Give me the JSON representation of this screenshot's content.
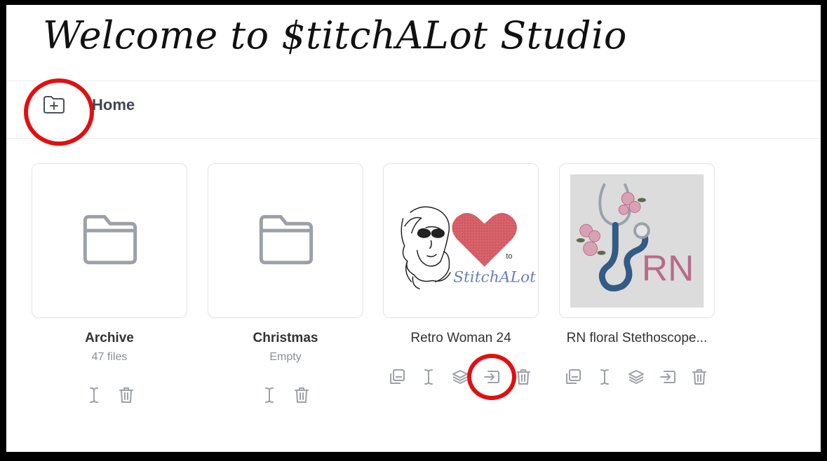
{
  "banner": {
    "title": "Welcome to $titchALot Studio"
  },
  "breadcrumb": {
    "current": "Home"
  },
  "new_folder_icon": "folder-plus-icon",
  "folders": [
    {
      "name": "Archive",
      "meta": "47 files"
    },
    {
      "name": "Christmas",
      "meta": "Empty"
    }
  ],
  "patterns": [
    {
      "name": "Retro Woman 24",
      "thumb_text": "to",
      "thumb_brand": "StitchALot"
    },
    {
      "name": "RN floral Stethoscope...",
      "thumb_text": "RN"
    }
  ],
  "colors": {
    "highlight": "#e11010",
    "icon": "#9ca0a8",
    "heart": "#d9636b",
    "rn": "#b96b89",
    "stetho": "#345a86"
  }
}
